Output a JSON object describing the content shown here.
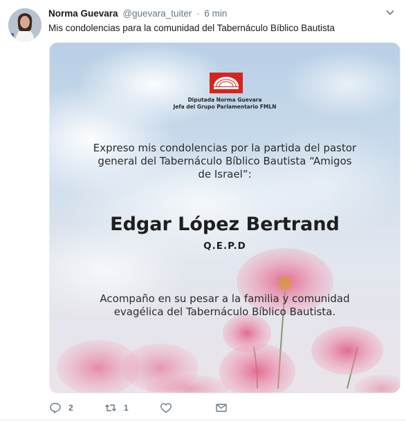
{
  "tweet": {
    "author_name": "Norma Guevara",
    "handle": "@guevara_tuiter",
    "separator": "·",
    "time": "6 min",
    "text": "Mis condolencias para la comunidad del Tabernáculo Bíblico Bautista"
  },
  "image": {
    "logo_line1": "Diputada Norma Guevara",
    "logo_line2": "Jefa del Grupo Parlamentario FMLN",
    "message_line1": "Expreso mis condolencias por la partida del pastor",
    "message_line2": "general del Tabernáculo Bíblico Bautista “Amigos",
    "message_line3": "de Israel”:",
    "person_name": "Edgar López Bertrand",
    "qepd": "Q.E.P.D",
    "closing_line1": "Acompaño en su pesar a la familia y comunidad",
    "closing_line2": "evagélica del Tabernáculo Bíblico Bautista."
  },
  "actions": {
    "reply_count": "2",
    "retweet_count": "1",
    "like_count": ""
  },
  "colors": {
    "text_primary": "#14171a",
    "text_secondary": "#657786",
    "logo_red": "#d7241d",
    "flower_pink": "#e8708f"
  },
  "icons": [
    "avatar",
    "chevron-down-icon",
    "reply-icon",
    "retweet-icon",
    "like-icon",
    "message-icon"
  ]
}
